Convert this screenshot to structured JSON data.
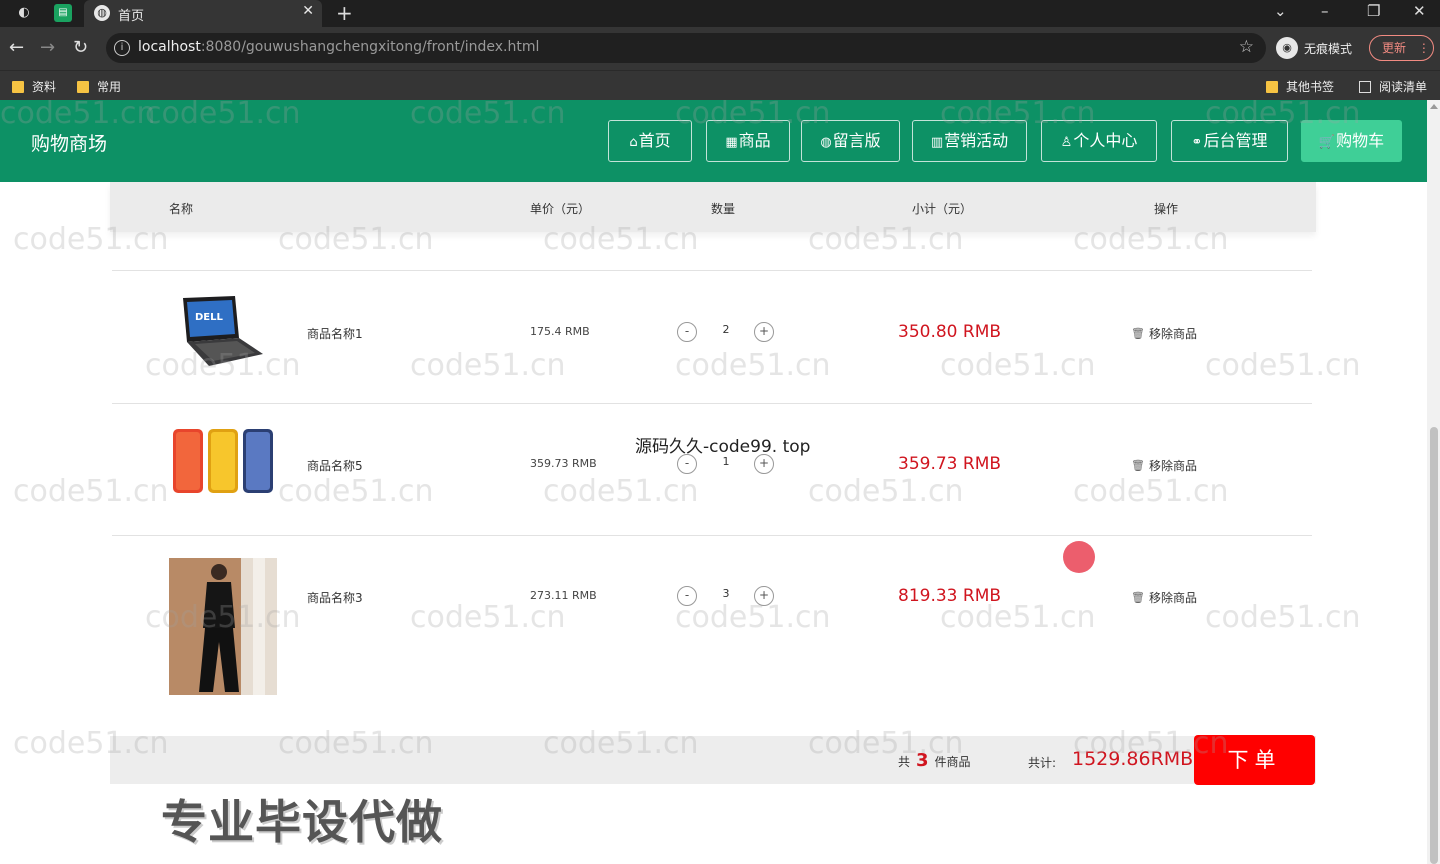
{
  "browser": {
    "tab_title": "首页",
    "url_host": "localhost",
    "url_rest": ":8080/gouwushangchengxitong/front/index.html",
    "profile_label": "无痕模式",
    "update_label": "更新",
    "bookmarks": [
      "资料",
      "常用"
    ],
    "bookmarks_right": [
      "其他书签",
      "阅读清单"
    ]
  },
  "site": {
    "brand": "购物商场",
    "nav": [
      {
        "label": "首页",
        "icon": "home-icon"
      },
      {
        "label": "商品",
        "icon": "calendar-icon"
      },
      {
        "label": "留言版",
        "icon": "globe-icon"
      },
      {
        "label": "营销活动",
        "icon": "grid-icon"
      },
      {
        "label": "个人中心",
        "icon": "user-icon"
      },
      {
        "label": "后台管理",
        "icon": "link-icon"
      },
      {
        "label": "购物车",
        "icon": "cart-icon"
      }
    ]
  },
  "cart": {
    "headers": [
      "名称",
      "单价（元）",
      "数量",
      "小计（元）",
      "操作"
    ],
    "items": [
      {
        "name": "商品名称1",
        "price": "175.4 RMB",
        "qty": "2",
        "subtotal": "350.80 RMB",
        "image": "laptop"
      },
      {
        "name": "商品名称5",
        "price": "359.73 RMB",
        "qty": "1",
        "subtotal": "359.73 RMB",
        "image": "phones"
      },
      {
        "name": "商品名称3",
        "price": "273.11 RMB",
        "qty": "3",
        "subtotal": "819.33 RMB",
        "image": "suit"
      }
    ],
    "minus": "-",
    "plus": "+",
    "remove_label": "移除商品",
    "count_prefix": "共",
    "count": "3",
    "count_suffix": "件商品",
    "total_label": "共计:",
    "total": "1529.86RMB",
    "order_button": "下单"
  },
  "overlay": {
    "watermark": "code51.cn",
    "middle_text": "源码久久-code99. top",
    "bottom_text": "专业毕设代做"
  }
}
